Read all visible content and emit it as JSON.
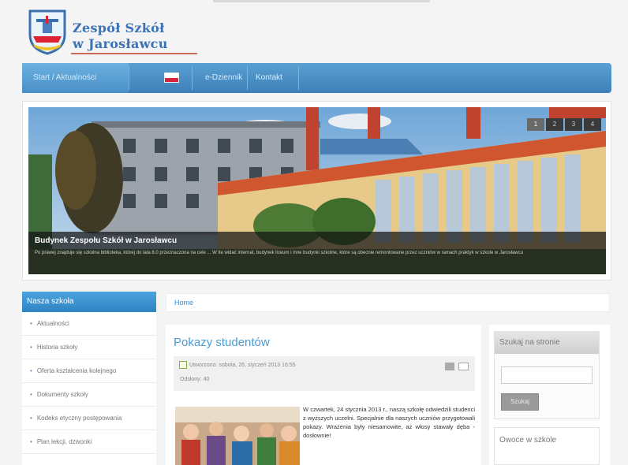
{
  "logo": {
    "line1": "Zespół Szkół",
    "line2": "w Jarosławcu"
  },
  "nav": {
    "items": [
      {
        "label": "Start / Aktualności"
      },
      {
        "label": "e-Dziennik"
      },
      {
        "label": "Kontakt"
      }
    ]
  },
  "slider": {
    "caption_title": "Budynek Zespołu Szkół w Jarosławcu",
    "caption_text": "Po prawej znajduje się szkolna biblioteka, której do lata 8.0 przeznaczona na cele ... W tle widać internat, budynek liceum i inne budynki szkolne, które są obecnie remontowane przez uczniów w ramach praktyk w szkole w Jarosławcu",
    "controls": [
      "1",
      "2",
      "3",
      "4"
    ]
  },
  "sidebar": {
    "title": "Nasza szkoła",
    "items": [
      {
        "label": "Aktualności"
      },
      {
        "label": "Historia szkoły"
      },
      {
        "label": "Oferta kształcenia kolejnego"
      },
      {
        "label": "Dokumenty szkoły"
      },
      {
        "label": "Kodeks etyczny postępowania"
      },
      {
        "label": "Plan lekcji, dzwonki"
      }
    ]
  },
  "breadcrumb": {
    "home": "Home"
  },
  "article": {
    "title": "Pokazy studentów",
    "date": "Utworzono: sobota, 26, styczeń 2013 16:55",
    "views": "Odsłony: 40",
    "text": "W czwartek, 24 stycznia 2013 r., naszą szkołę odwiedzili studenci z wyższych uczelni. Specjalnie dla naszych uczniów przygotowali pokazy. Wrażenia były niesamowite, aż włosy stawały dęba - dosłownie!"
  },
  "right": {
    "search_title": "Szukaj na stronie",
    "search_placeholder": "",
    "search_button": "Szukaj",
    "fruit_title": "Owoce w szkole"
  },
  "colors": {
    "nav": "#3d80b9",
    "accent": "#4b9bd4",
    "sidebar_header": "#2f84c3"
  }
}
